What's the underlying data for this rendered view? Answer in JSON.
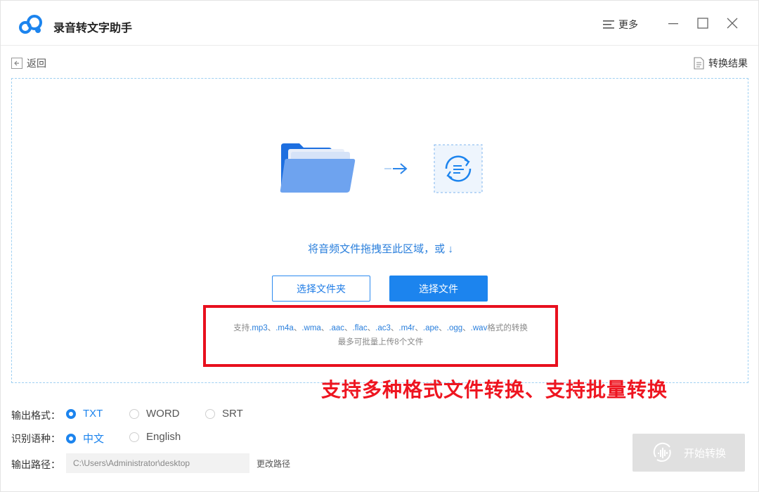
{
  "app": {
    "title": "录音转文字助手",
    "more_label": "更多"
  },
  "toolbar": {
    "back_label": "返回",
    "result_label": "转换结果"
  },
  "dropzone": {
    "hint": "将音频文件拖拽至此区域，或 ↓",
    "select_folder_label": "选择文件夹",
    "select_file_label": "选择文件",
    "formats_prefix": "支持",
    "formats_list": [
      ".mp3",
      ".m4a",
      ".wma",
      ".aac",
      ".flac",
      ".ac3",
      ".m4r",
      ".ape",
      ".ogg",
      ".wav"
    ],
    "formats_separator": "、",
    "formats_suffix": "格式的转换",
    "batch_note": "最多可批量上传8个文件"
  },
  "annotation": {
    "text": "支持多种格式文件转换、支持批量转换",
    "color": "#ee1520"
  },
  "options": {
    "output_format": {
      "label": "输出格式：",
      "choices": [
        "TXT",
        "WORD",
        "SRT"
      ],
      "selected": "TXT"
    },
    "language": {
      "label": "识别语种：",
      "choices": [
        "中文",
        "English"
      ],
      "selected": "中文"
    },
    "output_path": {
      "label": "输出路径：",
      "value": "C:\\Users\\Administrator\\desktop",
      "change_label": "更改路径"
    }
  },
  "start_label": "开始转换",
  "colors": {
    "accent": "#1c84ee",
    "disabled": "#e0e0e0"
  },
  "icons": [
    "app-logo-icon",
    "menu-lines-icon",
    "minimize-icon",
    "maximize-icon",
    "close-icon",
    "back-arrow-icon",
    "document-icon",
    "folder-icon",
    "arrow-right-icon",
    "audio-convert-icon",
    "audio-wave-icon"
  ]
}
